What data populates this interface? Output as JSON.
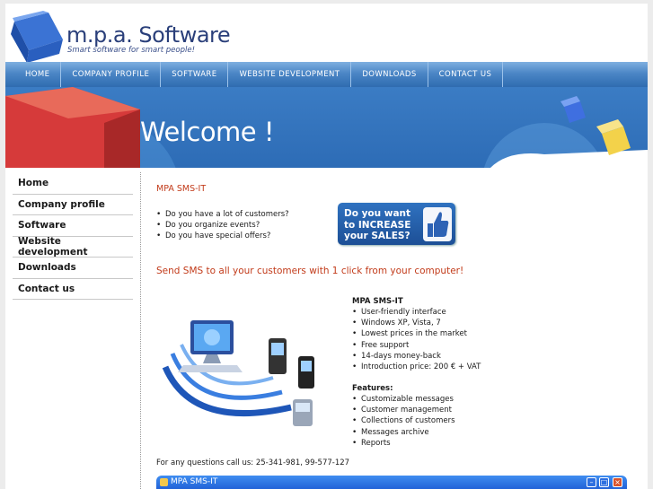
{
  "header": {
    "brand": "m.p.a. Software",
    "tagline": "Smart software for smart people!"
  },
  "nav": {
    "items": [
      "HOME",
      "COMPANY PROFILE",
      "SOFTWARE",
      "WEBSITE DEVELOPMENT",
      "DOWNLOADS",
      "CONTACT US"
    ]
  },
  "banner": {
    "welcome": "Welcome !"
  },
  "sidebar": {
    "items": [
      "Home",
      "Company profile",
      "Software",
      "Website development",
      "Downloads",
      "Contact us"
    ]
  },
  "main": {
    "title": "MPA SMS-IT",
    "questions": [
      "Do you have a lot of customers?",
      "Do you organize events?",
      "Do you have special offers?"
    ],
    "promo": {
      "line1": "Do you want",
      "line2": "to INCREASE",
      "line3": "your SALES?"
    },
    "send_line": "Send SMS to all your customers with 1 click from your computer!",
    "product_title": "MPA SMS-IT",
    "benefits": [
      "User-friendly interface",
      "Windows XP, Vista, 7",
      "Lowest prices in the market",
      "Free support",
      "14-days money-back",
      "Introduction price: 200 € + VAT"
    ],
    "features_title": "Features:",
    "features": [
      "Customizable messages",
      "Customer management",
      "Collections of customers",
      "Messages archive",
      "Reports"
    ],
    "contact_line": "For any questions call us: 25-341-981, 99-577-127"
  },
  "window": {
    "title": "MPA SMS-IT"
  },
  "colors": {
    "accent": "#c23b1a",
    "nav": "#4b86c6",
    "brand": "#2a3f7a"
  }
}
